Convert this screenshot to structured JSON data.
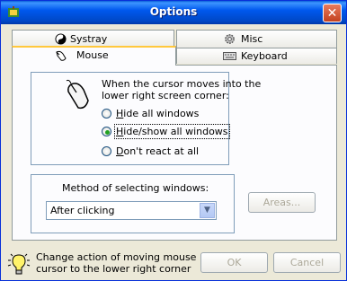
{
  "window": {
    "title": "Options",
    "close_glyph": "✕"
  },
  "tabs": [
    {
      "label": "Systray",
      "icon": "yin-yang-icon",
      "selected": false
    },
    {
      "label": "Misc",
      "icon": "gear-icon",
      "selected": false
    },
    {
      "label": "Mouse",
      "icon": "mouse-icon",
      "selected": true
    },
    {
      "label": "Keyboard",
      "icon": "keyboard-icon",
      "selected": false
    }
  ],
  "mouse_tab": {
    "corner_text_line1": "When the cursor moves into the",
    "corner_text_line2": "lower right screen corner:",
    "options": [
      {
        "label": "Hide all windows",
        "mnemonic": "H",
        "rest": "ide all windows",
        "selected": false
      },
      {
        "label": "Hide/show all windows",
        "mnemonic": "H",
        "rest": "ide/show all windows",
        "selected": true
      },
      {
        "label": "Don't react at all",
        "mnemonic": "D",
        "rest": "on't react at all",
        "selected": false
      }
    ],
    "method_label": "Method of selecting windows:",
    "method_value": "After clicking",
    "areas_button": "Areas..."
  },
  "footer": {
    "hint_line1": "Change action of moving mouse",
    "hint_line2": "cursor to the lower right corner",
    "ok": "OK",
    "cancel": "Cancel"
  },
  "colors": {
    "titlebar": "#0058ee",
    "selected_radio": "#21a121",
    "tab_highlight": "#ffc83c"
  }
}
